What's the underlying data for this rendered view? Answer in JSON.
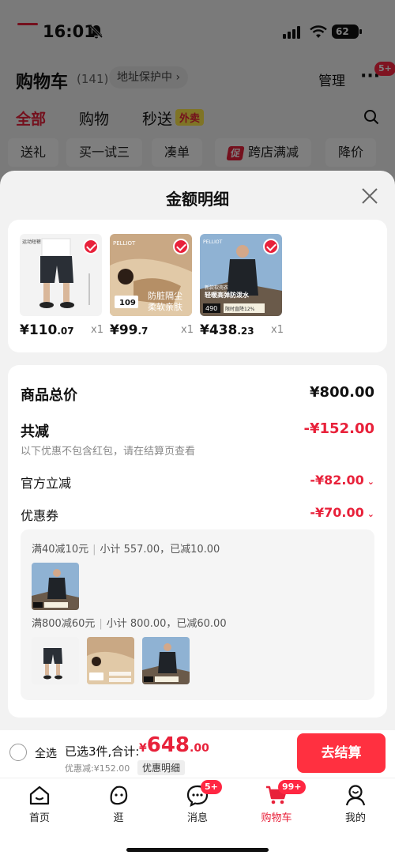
{
  "status": {
    "time": "16:01",
    "battery": "62"
  },
  "header": {
    "title": "购物车",
    "count": "(141)",
    "address": "地址保护中 ›",
    "manage": "管理",
    "more": "···",
    "more_badge": "5+"
  },
  "tabs": [
    {
      "label": "全部"
    },
    {
      "label": "购物"
    },
    {
      "label": "秒送"
    }
  ],
  "waimai_tag": "外卖",
  "chips": [
    {
      "label": "送礼"
    },
    {
      "label": "买一试三"
    },
    {
      "label": "凑单"
    },
    {
      "label": "跨店满减",
      "tag": "促"
    },
    {
      "label": "降价"
    }
  ],
  "sheet": {
    "title": "金额明细",
    "products": [
      {
        "price_int": "¥110",
        "price_dec": ".07",
        "qty": "x1"
      },
      {
        "price_int": "¥99",
        "price_dec": ".7",
        "qty": "x1"
      },
      {
        "price_int": "¥438",
        "price_dec": ".23",
        "qty": "x1"
      }
    ],
    "summary": {
      "goods_total_label": "商品总价",
      "goods_total_value": "¥800.00",
      "reduce_label": "共减",
      "reduce_value": "-¥152.00",
      "reduce_hint": "以下优惠不包含红包，请在结算页查看",
      "official_label": "官方立减",
      "official_value": "-¥82.00",
      "coupon_label": "优惠券",
      "coupon_value": "-¥70.00"
    },
    "coupons": [
      {
        "rule": "满40减10元",
        "detail": "小计 557.00，已减10.00"
      },
      {
        "rule": "满800减60元",
        "detail": "小计 800.00，已减60.00"
      }
    ],
    "thumb_text": {
      "brand": "PELLIOT",
      "p1_caption": "运动短裤",
      "p2_promo": "109",
      "p2_line1": "防脏隔尘",
      "p2_line2": "柔软亲肤",
      "p3_line1": "新款软壳衣",
      "p3_line2": "轻暖高弹防泼水",
      "p3_price": "490",
      "p3_note": "限时直降12%"
    }
  },
  "actionbar": {
    "select_all": "全选",
    "selected": "已选3件,合计:",
    "total_sym": "¥",
    "total_int": "648",
    "total_dec": ".00",
    "discount": "优惠减:¥152.00",
    "detail": "优惠明细",
    "checkout": "去结算"
  },
  "tabbar": [
    {
      "label": "首页",
      "icon": "home-icon"
    },
    {
      "label": "逛",
      "icon": "browse-icon"
    },
    {
      "label": "消息",
      "icon": "message-icon",
      "badge": "5+"
    },
    {
      "label": "购物车",
      "icon": "cart-icon",
      "badge": "99+",
      "active": true
    },
    {
      "label": "我的",
      "icon": "profile-icon"
    }
  ],
  "colors": {
    "accent": "#e8213a",
    "checkout": "#ff3040"
  }
}
